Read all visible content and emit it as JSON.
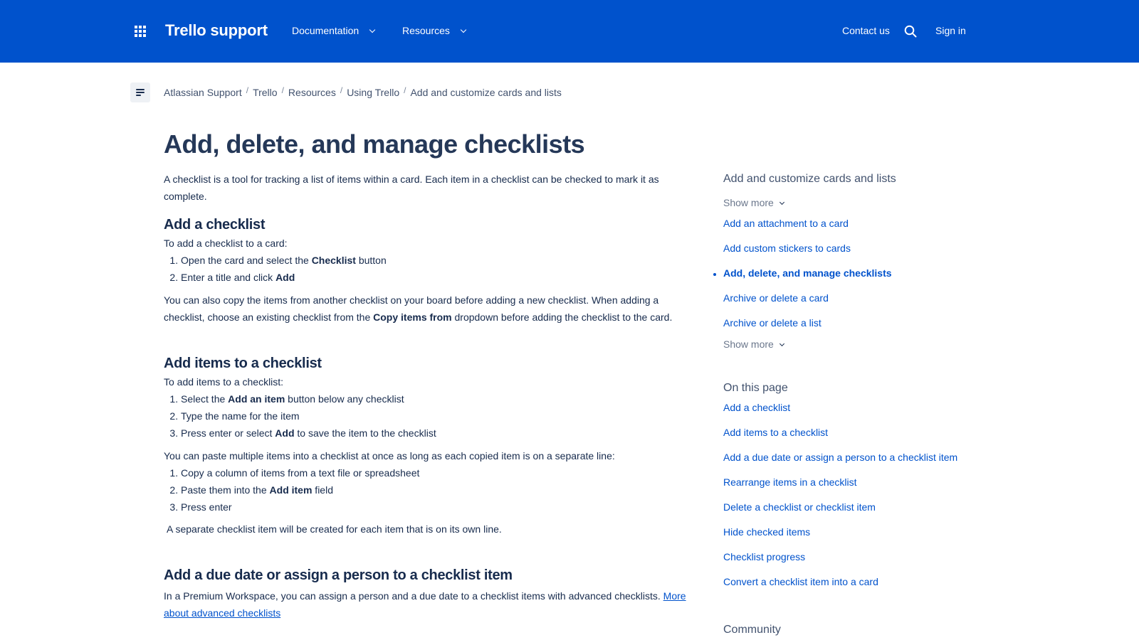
{
  "header": {
    "brand": "Trello support",
    "nav": [
      {
        "label": "Documentation"
      },
      {
        "label": "Resources"
      }
    ],
    "contact": "Contact us",
    "signin": "Sign in",
    "colors": {
      "bar": "#0052cc",
      "text": "#ffffff"
    }
  },
  "breadcrumb": [
    "Atlassian Support",
    "Trello",
    "Resources",
    "Using Trello",
    "Add and customize cards and lists"
  ],
  "article": {
    "title": "Add, delete, and manage checklists",
    "intro": "A checklist is a tool for tracking a list of items within a card. Each item in a checklist can be checked to mark it as complete.",
    "sec1": {
      "heading": "Add a checklist",
      "lead": "To add a checklist to a card:",
      "step1_pre": "Open the card and select the ",
      "step1_bold": "Checklist",
      "step1_post": " button",
      "step2_pre": "Enter a title and click ",
      "step2_bold": "Add",
      "copy_pre": "You can also copy the items from another checklist on your board before adding a new checklist. When adding a checklist, choose an existing checklist from the ",
      "copy_bold": "Copy items from",
      "copy_post": " dropdown before adding the checklist to the card."
    },
    "sec2": {
      "heading": "Add items to a checklist",
      "lead": "To add items to a checklist:",
      "step1_pre": "Select the ",
      "step1_bold": "Add an item",
      "step1_post": " button below any checklist",
      "step2": "Type the name for the item",
      "step3_pre": "Press enter or select ",
      "step3_bold": "Add",
      "step3_post": " to save the item to the checklist",
      "paste_lead": "You can paste multiple items into a checklist at once as long as each copied item is on a separate line:",
      "paste1": "Copy a column of items from a text file or spreadsheet",
      "paste2_pre": "Paste them into the ",
      "paste2_bold": "Add item",
      "paste2_post": " field",
      "paste3": "Press enter",
      "note": "A separate checklist item will be created for each item that is on its own line."
    },
    "sec3": {
      "heading": "Add a due date or assign a person to a checklist item",
      "text": "In a Premium Workspace, you can assign a person and a due date to a checklist items with advanced checklists. ",
      "link": "More about advanced checklists"
    }
  },
  "sidebar": {
    "section_title": "Add and customize cards and lists",
    "show_more": "Show more",
    "links": [
      "Add an attachment to a card",
      "Add custom stickers to cards",
      "Add, delete, and manage checklists",
      "Archive or delete a card",
      "Archive or delete a list"
    ],
    "on_this_page_title": "On this page",
    "on_this_page": [
      "Add a checklist",
      "Add items to a checklist",
      "Add a due date or assign a person to a checklist item",
      "Rearrange items in a checklist",
      "Delete a checklist or checklist item",
      "Hide checked items",
      "Checklist progress",
      "Convert a checklist item into a card"
    ],
    "community_title": "Community"
  }
}
